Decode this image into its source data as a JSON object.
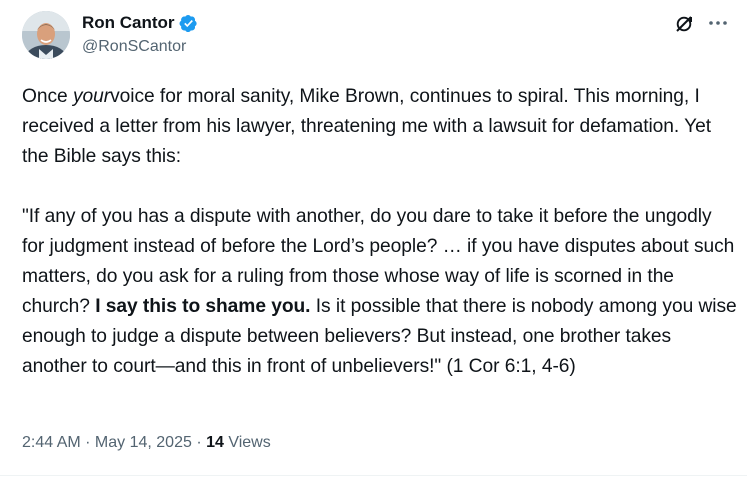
{
  "author": {
    "display_name": "Ron Cantor",
    "handle": "@RonSCantor",
    "verified": true
  },
  "icons": {
    "avatar": "profile-photo",
    "verified": "verified-badge-icon",
    "grok": "grok-icon",
    "more": "more-options-icon"
  },
  "colors": {
    "text": "#0f1419",
    "secondary": "#536471",
    "verified_blue": "#1d9bf0"
  },
  "tweet": {
    "p1_a": "Once ",
    "p1_em": "your",
    "p1_b": "voice for moral sanity, Mike Brown, continues to spiral. This morning, I received a letter from his lawyer, threatening me with a lawsuit for defamation. Yet the Bible says this:",
    "p2_a": "\"If any of you has a dispute with another, do you dare to take it before the ungodly for judgment instead of before the Lord’s people? … if you have disputes about such matters, do you ask for a ruling from those whose way of life is scorned in the church? ",
    "p2_bold": "I say this to shame you.",
    "p2_b": " Is it possible that there is nobody among you wise enough to judge a dispute between believers? But instead, one brother takes another to court—and this in front of unbelievers!\" (1 Cor 6:1, 4-6)"
  },
  "meta": {
    "time": "2:44 AM",
    "sep1": " · ",
    "date": "May 14, 2025",
    "sep2": " · ",
    "views_count": "14",
    "views_label": " Views"
  }
}
